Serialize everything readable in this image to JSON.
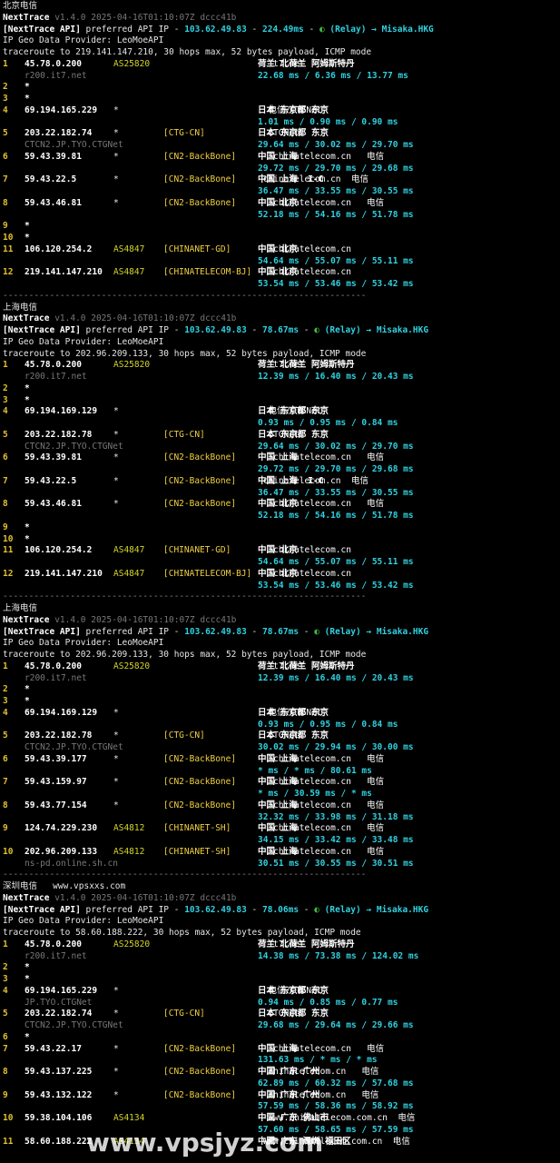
{
  "window": {
    "title": "NextTrace terminal output"
  },
  "blocks": [
    {
      "title": "北京电信",
      "header": {
        "app": "NextTrace",
        "version": "v1.4.0 2025-04-16T01:10:07Z dccc41b"
      },
      "api_line": {
        "label": "[NextTrace API]",
        "text1": " preferred API IP - ",
        "ip": "103.62.49.83",
        "dash": " - ",
        "ms": "224.49ms",
        "text2": " - ",
        "relay": "(Relay) → Misaka.HKG"
      },
      "geo_provider": "IP Geo Data Provider: LeoMoeAPI",
      "traceroute": "traceroute to 219.141.147.210, 30 hops max, 52 bytes payload, ICMP mode",
      "hops": [
        {
          "n": "1",
          "ip": "45.78.0.200",
          "as": "AS25820",
          "tag": "",
          "geo": "荷兰 北荷兰 阿姆斯特丹",
          "geo2": "  it7.net",
          "host": "r200.it7.net",
          "lat": "22.68 ms / 6.36 ms / 13.77 ms"
        },
        {
          "n": "2",
          "ip": "*"
        },
        {
          "n": "3",
          "ip": "*"
        },
        {
          "n": "4",
          "ip": "69.194.165.229",
          "star": "*",
          "geo": "日本 东京都 东京",
          "geo2": "  电信/CTGNet",
          "lat": "1.01 ms / 0.90 ms / 0.90 ms"
        },
        {
          "n": "5",
          "ip": "203.22.182.74",
          "star": "*",
          "tag": "[CTG-CN]",
          "geo": "日本 东京都 东京",
          "geo2": "  CTGNet",
          "host": "CTCN2.JP.TYO.CTGNet",
          "lat": "29.64 ms / 30.02 ms / 29.70 ms"
        },
        {
          "n": "6",
          "ip": "59.43.39.81",
          "star": "*",
          "tag": "[CN2-BackBone]",
          "geo": "中国 上海",
          "geo2": "   chinatelecom.cn   电信",
          "lat": "29.72 ms / 29.70 ms / 29.68 ms"
        },
        {
          "n": "7",
          "ip": "59.43.22.5",
          "star": "*",
          "tag": "[CN2-BackBone]",
          "geo": "中国 上海  I-C",
          "geo2": " chinatelecom.cn  电信",
          "lat": "36.47 ms / 33.55 ms / 30.55 ms"
        },
        {
          "n": "8",
          "ip": "59.43.46.81",
          "star": "*",
          "tag": "[CN2-BackBone]",
          "geo": "中国 北京",
          "geo2": "   chinatelecom.cn   电信",
          "lat": "52.18 ms / 54.16 ms / 51.78 ms"
        },
        {
          "n": "9",
          "ip": "*"
        },
        {
          "n": "10",
          "ip": "*"
        },
        {
          "n": "11",
          "ip": "106.120.254.2",
          "as": "AS4847",
          "tag": "[CHINANET-GD]",
          "geo": "中国 北京",
          "geo2": "   chinatelecom.cn",
          "lat": "54.64 ms / 55.07 ms / 55.11 ms"
        },
        {
          "n": "12",
          "ip": "219.141.147.210",
          "as": "AS4847",
          "tag": "[CHINATELECOM-BJ]",
          "geo": "中国 北京",
          "geo2": "   chinatelecom.cn",
          "lat": "53.54 ms / 53.46 ms / 53.42 ms"
        }
      ]
    },
    {
      "title": "上海电信",
      "header": {
        "app": "NextTrace",
        "version": "v1.4.0 2025-04-16T01:10:07Z dccc41b"
      },
      "api_line": {
        "label": "[NextTrace API]",
        "text1": " preferred API IP - ",
        "ip": "103.62.49.83",
        "dash": " - ",
        "ms": "78.67ms",
        "text2": " - ",
        "relay": "(Relay) → Misaka.HKG"
      },
      "geo_provider": "IP Geo Data Provider: LeoMoeAPI",
      "traceroute": "traceroute to 202.96.209.133, 30 hops max, 52 bytes payload, ICMP mode",
      "hops": [
        {
          "n": "1",
          "ip": "45.78.0.200",
          "as": "AS25820",
          "geo": "荷兰 北荷兰 阿姆斯特丹",
          "geo2": "  it7.net",
          "host": "r200.it7.net",
          "lat": "12.39 ms / 16.40 ms / 20.43 ms"
        },
        {
          "n": "2",
          "ip": "*"
        },
        {
          "n": "3",
          "ip": "*"
        },
        {
          "n": "4",
          "ip": "69.194.169.129",
          "star": "*",
          "geo": "日本 东京都 东京",
          "geo2": "  电信/CTGNet",
          "lat": "0.93 ms / 0.95 ms / 0.84 ms"
        },
        {
          "n": "5",
          "ip": "203.22.182.78",
          "star": "*",
          "tag": "[CTG-CN]",
          "geo": "日本 东京都 东京",
          "geo2": "  CTGNet",
          "host": "CTCN2.JP.TYO.CTGNet",
          "lat": "29.64 ms / 30.02 ms / 29.70 ms"
        },
        {
          "n": "6",
          "ip": "59.43.39.81",
          "star": "*",
          "tag": "[CN2-BackBone]",
          "geo": "中国 上海",
          "geo2": "   chinatelecom.cn   电信",
          "lat": "29.72 ms / 29.70 ms / 29.68 ms"
        },
        {
          "n": "7",
          "ip": "59.43.22.5",
          "star": "*",
          "tag": "[CN2-BackBone]",
          "geo": "中国 上海  I-C",
          "geo2": " chinatelecom.cn  电信",
          "lat": "36.47 ms / 33.55 ms / 30.55 ms"
        },
        {
          "n": "8",
          "ip": "59.43.46.81",
          "star": "*",
          "tag": "[CN2-BackBone]",
          "geo": "中国 北京",
          "geo2": "   chinatelecom.cn   电信",
          "lat": "52.18 ms / 54.16 ms / 51.78 ms"
        },
        {
          "n": "9",
          "ip": "*"
        },
        {
          "n": "10",
          "ip": "*"
        },
        {
          "n": "11",
          "ip": "106.120.254.2",
          "as": "AS4847",
          "tag": "[CHINANET-GD]",
          "geo": "中国 北京",
          "geo2": "   chinatelecom.cn",
          "lat": "54.64 ms / 55.07 ms / 55.11 ms"
        },
        {
          "n": "12",
          "ip": "219.141.147.210",
          "as": "AS4847",
          "tag": "[CHINATELECOM-BJ]",
          "geo": "中国 北京",
          "geo2": "   chinatelecom.cn",
          "lat": "53.54 ms / 53.46 ms / 53.42 ms"
        }
      ]
    },
    {
      "title": "上海电信",
      "header": {
        "app": "NextTrace",
        "version": "v1.4.0 2025-04-16T01:10:07Z dccc41b"
      },
      "api_line": {
        "label": "[NextTrace API]",
        "text1": " preferred API IP - ",
        "ip": "103.62.49.83",
        "dash": " - ",
        "ms": "78.67ms",
        "text2": " - ",
        "relay": "(Relay) → Misaka.HKG"
      },
      "geo_provider": "IP Geo Data Provider: LeoMoeAPI",
      "traceroute": "traceroute to 202.96.209.133, 30 hops max, 52 bytes payload, ICMP mode",
      "hops": [
        {
          "n": "1",
          "ip": "45.78.0.200",
          "as": "AS25820",
          "geo": "荷兰 北荷兰 阿姆斯特丹",
          "geo2": "  it7.net",
          "host": "r200.it7.net",
          "lat": "12.39 ms / 16.40 ms / 20.43 ms"
        },
        {
          "n": "2",
          "ip": "*"
        },
        {
          "n": "3",
          "ip": "*"
        },
        {
          "n": "4",
          "ip": "69.194.169.129",
          "star": "*",
          "geo": "日本 东京都 东京",
          "geo2": "  电信/CTGNet",
          "lat": "0.93 ms / 0.95 ms / 0.84 ms"
        },
        {
          "n": "5",
          "ip": "203.22.182.78",
          "star": "*",
          "tag": "[CTG-CN]",
          "geo": "日本 东京都 东京",
          "geo2": "  CTGNet",
          "host": "CTCN2.JP.TYO.CTGNet",
          "lat": "30.02 ms / 29.94 ms / 30.00 ms"
        },
        {
          "n": "6",
          "ip": "59.43.39.177",
          "star": "*",
          "tag": "[CN2-BackBone]",
          "geo": "中国 上海",
          "geo2": "   chinatelecom.cn   电信",
          "lat": "* ms / * ms / 80.61 ms"
        },
        {
          "n": "7",
          "ip": "59.43.159.97",
          "star": "*",
          "tag": "[CN2-BackBone]",
          "geo": "中国 上海",
          "geo2": "   chinatelecom.cn   电信",
          "lat": "* ms / 30.59 ms / * ms"
        },
        {
          "n": "8",
          "ip": "59.43.77.154",
          "star": "*",
          "tag": "[CN2-BackBone]",
          "geo": "中国 上海",
          "geo2": "   chinatelecom.cn   电信",
          "lat": "32.32 ms / 33.98 ms / 31.18 ms"
        },
        {
          "n": "9",
          "ip": "124.74.229.230",
          "as": "AS4812",
          "tag": "[CHINANET-SH]",
          "geo": "中国 上海",
          "geo2": "   chinatelecom.cn   电信",
          "lat": "34.15 ms / 33.42 ms / 33.48 ms"
        },
        {
          "n": "10",
          "ip": "202.96.209.133",
          "as": "AS4812",
          "tag": "[CHINANET-SH]",
          "geo": "中国 上海",
          "geo2": "   chinatelecom.cn   电信",
          "host": "ns-pd.online.sh.cn",
          "lat": "30.51 ms / 30.55 ms / 30.51 ms"
        }
      ]
    },
    {
      "title": "深圳电信",
      "title_extra": "www.vpsxxs.com",
      "header": {
        "app": "NextTrace",
        "version": "v1.4.0 2025-04-16T01:10:07Z dccc41b"
      },
      "api_line": {
        "label": "[NextTrace API]",
        "text1": " preferred API IP - ",
        "ip": "103.62.49.83",
        "dash": " - ",
        "ms": "78.06ms",
        "text2": " - ",
        "relay": "(Relay) → Misaka.HKG"
      },
      "geo_provider": "IP Geo Data Provider: LeoMoeAPI",
      "traceroute": "traceroute to 58.60.188.222, 30 hops max, 52 bytes payload, ICMP mode",
      "hops": [
        {
          "n": "1",
          "ip": "45.78.0.200",
          "as": "AS25820",
          "geo": "荷兰 北荷兰 阿姆斯特丹",
          "geo2": "  it7.net",
          "host": "r200.it7.net",
          "lat": "14.38 ms / 73.38 ms / 124.02 ms"
        },
        {
          "n": "2",
          "ip": "*"
        },
        {
          "n": "3",
          "ip": "*"
        },
        {
          "n": "4",
          "ip": "69.194.165.229",
          "star": "*",
          "geo": "日本 东京都 东京",
          "geo2": "  电信/CTGNet",
          "host": "JP.TYO.CTGNet",
          "lat": "0.94 ms / 0.85 ms / 0.77 ms"
        },
        {
          "n": "5",
          "ip": "203.22.182.74",
          "star": "*",
          "tag": "[CTG-CN]",
          "geo": "日本 东京都 东京",
          "geo2": "  CTGNet",
          "host": "CTCN2.JP.TYO.CTGNet",
          "lat": "29.68 ms / 29.64 ms / 29.66 ms"
        },
        {
          "n": "6",
          "ip": "*"
        },
        {
          "n": "7",
          "ip": "59.43.22.17",
          "star": "*",
          "tag": "[CN2-BackBone]",
          "geo": "中国 上海",
          "geo2": "   chinatelecom.cn   电信",
          "lat": "131.63 ms / * ms / * ms"
        },
        {
          "n": "8",
          "ip": "59.43.137.225",
          "star": "*",
          "tag": "[CN2-BackBone]",
          "geo": "中国 广东 广州",
          "geo2": "  chinatelecom.cn   电信",
          "lat": "62.89 ms / 60.32 ms / 57.68 ms"
        },
        {
          "n": "9",
          "ip": "59.43.132.122",
          "star": "*",
          "tag": "[CN2-BackBone]",
          "geo": "中国 广东 广州",
          "geo2": "  chinatelecom.cn   电信",
          "lat": "57.59 ms / 58.36 ms / 58.92 ms"
        },
        {
          "n": "10",
          "ip": "59.38.104.106",
          "as": "AS4134",
          "geo": "中国 广东 佛山市",
          "geo2": "  www.chinatelecom.com.cn  电信",
          "lat": "57.60 ms / 58.65 ms / 57.59 ms"
        },
        {
          "n": "11",
          "ip": "58.60.188.222",
          "as": "AS4134",
          "geo": "中国 广东 深圳 福田区",
          "geo2": " www.chinatelecom.com.cn  电信",
          "lat": ""
        }
      ]
    }
  ],
  "separator": "----------------------------------------------------------------------",
  "watermark": "www.vpsjyz.com"
}
